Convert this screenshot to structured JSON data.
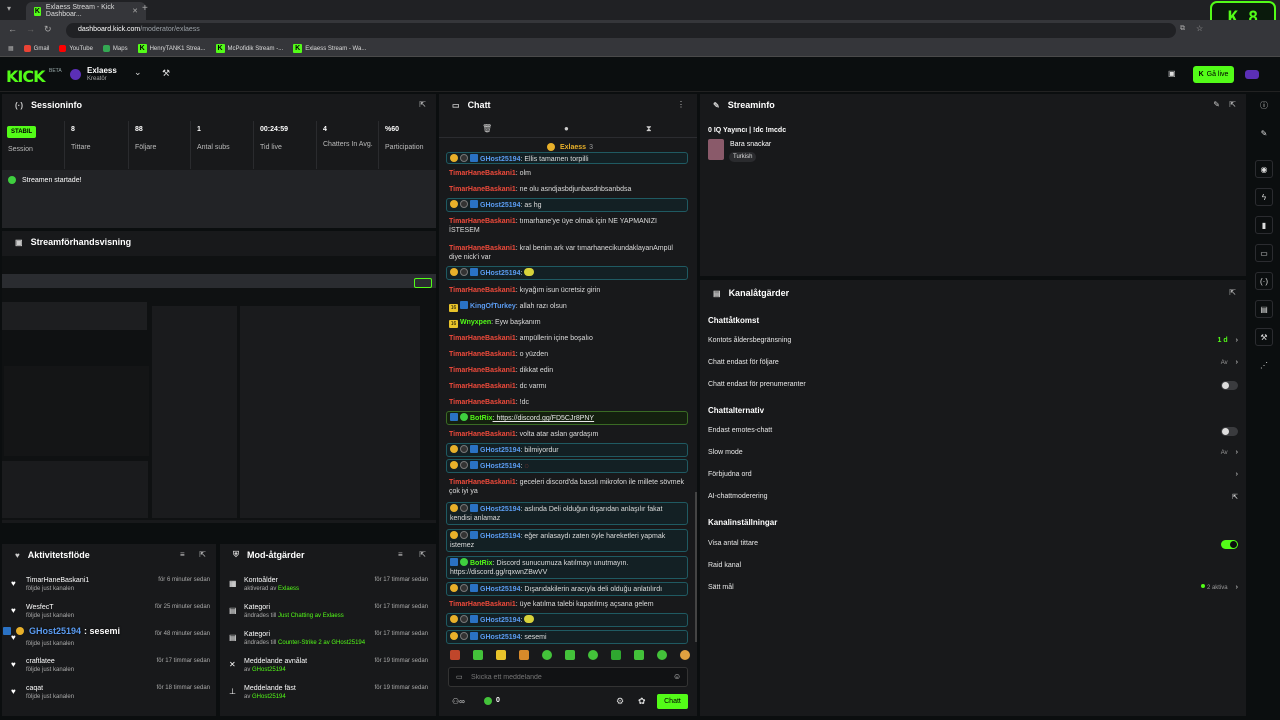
{
  "browser": {
    "tab_title": "Exlaess Stream - Kick Dashboar...",
    "url_host": "dashboard.kick.com",
    "url_path": "/moderator/exlaess",
    "bookmarks": [
      "Gmail",
      "YouTube",
      "Maps",
      "HenryTANK1 Strea...",
      "McPofidik Stream -...",
      "Exlaess Stream - Wa..."
    ]
  },
  "overlay_badge": {
    "letter": "K",
    "number": "8"
  },
  "topbar": {
    "logo": "KICK",
    "beta": "BETA",
    "channel_name": "Exlaess",
    "channel_role": "Kreatör",
    "go_live": "Gå live"
  },
  "session": {
    "title": "Sessioninfo",
    "status_badge": "STABIL",
    "status_label": "Session",
    "stats": [
      {
        "value": "8",
        "label": "Tittare"
      },
      {
        "value": "88",
        "label": "Följare"
      },
      {
        "value": "1",
        "label": "Antal subs"
      },
      {
        "value": "00:24:59",
        "label": "Tid live"
      },
      {
        "value": "4",
        "label": "Chatters In Avg."
      },
      {
        "value": "%60",
        "label": "Participation"
      }
    ],
    "event": "Streamen startade!"
  },
  "preview": {
    "title": "Streamförhandsvisning"
  },
  "activity": {
    "title": "Aktivitetsflöde",
    "items": [
      {
        "name": "TimarHaneBaskani1",
        "sub": "följde just kanalen",
        "time": "för 6 minuter sedan"
      },
      {
        "name": "WesfecT",
        "sub": "följde just kanalen",
        "time": "för 25 minuter sedan"
      },
      {
        "name": "",
        "sub": "följde just kanalen",
        "time": "för 48 minuter sedan"
      },
      {
        "name": "craftlatee",
        "sub": "följde just kanalen",
        "time": "för 17 timmar sedan"
      },
      {
        "name": "caqat",
        "sub": "följde just kanalen",
        "time": "för 18 timmar sedan"
      }
    ],
    "overlay_name": "GHost25194",
    "overlay_msg": ": sesemi"
  },
  "modactions": {
    "title": "Mod-åtgärder",
    "items": [
      {
        "title": "Kontoålder",
        "sub_prefix": "aktiverad av ",
        "sub_link": "Exlaess",
        "time": "för 17 timmar sedan"
      },
      {
        "title": "Kategori",
        "sub_prefix": "ändrades till ",
        "sub_link": "Just Chatting av Exlaess",
        "time": "för 17 timmar sedan"
      },
      {
        "title": "Kategori",
        "sub_prefix": "ändrades till ",
        "sub_link": "Counter-Strike 2 av GHost25194",
        "time": "för 17 timmar sedan"
      },
      {
        "title": "Meddelande avnålat",
        "sub_prefix": "av ",
        "sub_link": "GHost25194",
        "time": "för 19 timmar sedan"
      },
      {
        "title": "Meddelande fäst",
        "sub_prefix": "av ",
        "sub_link": "GHost25194",
        "time": "för 19 timmar sedan"
      }
    ]
  },
  "chat": {
    "title": "Chatt",
    "pinned_user": "Exlaess",
    "pinned_count": "3",
    "messages": [
      {
        "user": "GHost25194",
        "text": ": Ellis tamamen torpilli",
        "style": "box",
        "color": "blue"
      },
      {
        "user": "TimarHaneBaskani1",
        "text": ": olm",
        "style": "plain",
        "color": "red"
      },
      {
        "user": "TimarHaneBaskani1",
        "text": ": ne olu asndjasbdjunbasdnbsanbdsa",
        "style": "plain",
        "color": "red"
      },
      {
        "user": "GHost25194",
        "text": ": as hg",
        "style": "box",
        "color": "blue"
      },
      {
        "user": "TimarHaneBaskani1",
        "text": ": tımarhane'ye üye olmak için NE YAPMANIZI İSTESEM",
        "style": "plain",
        "color": "red"
      },
      {
        "user": "TimarHaneBaskani1",
        "text": ": kral benim ark var tımarhanecikundaklayanAmpül diye nick'i var",
        "style": "plain",
        "color": "red"
      },
      {
        "user": "GHost25194",
        "text": ":",
        "style": "box",
        "color": "blue"
      },
      {
        "user": "TimarHaneBaskani1",
        "text": ": kıyağım isun ücretsiz girin",
        "style": "plain",
        "color": "red"
      },
      {
        "user": "KingOfTurkey",
        "text": ": allah razı olsun",
        "style": "plain",
        "color": "blue"
      },
      {
        "user": "Wnyxpen",
        "text": ": Eyw başkanım",
        "style": "plain",
        "color": "green"
      },
      {
        "user": "TimarHaneBaskani1",
        "text": ": ampüllerin içine boşalıo",
        "style": "plain",
        "color": "red"
      },
      {
        "user": "TimarHaneBaskani1",
        "text": ": o yüzden",
        "style": "plain",
        "color": "red"
      },
      {
        "user": "TimarHaneBaskani1",
        "text": ": dikkat edin",
        "style": "plain",
        "color": "red"
      },
      {
        "user": "TimarHaneBaskani1",
        "text": ": dc varmı",
        "style": "plain",
        "color": "red"
      },
      {
        "user": "TimarHaneBaskani1",
        "text": ": !dc",
        "style": "plain",
        "color": "red"
      },
      {
        "user": "BotRix",
        "text": ": https://discord.gg/FD5CJr8PNY",
        "style": "gbox",
        "color": "green"
      },
      {
        "user": "TimarHaneBaskani1",
        "text": ": volta atar aslan gardaşım",
        "style": "plain",
        "color": "red"
      },
      {
        "user": "GHost25194",
        "text": ": bilmiyordur",
        "style": "box",
        "color": "blue"
      },
      {
        "user": "GHost25194",
        "text": ":",
        "style": "box",
        "color": "blue"
      },
      {
        "user": "TimarHaneBaskani1",
        "text": ": geceleri discord'da basslı mikrofon ile millete sövmek çok iyi ya",
        "style": "plain",
        "color": "red"
      },
      {
        "user": "GHost25194",
        "text": ": aslında Deli olduğun dışarıdan anlaşılır fakat kendisi anlamaz",
        "style": "box",
        "color": "blue"
      },
      {
        "user": "GHost25194",
        "text": ": eğer anlasaydı zaten öyle hareketleri yapmak istemez",
        "style": "box",
        "color": "blue"
      },
      {
        "user": "BotRix",
        "text": ": Discord sunucumuza katılmayı unutmayın. https://discord.gg/rqxwnZBwVV",
        "style": "box",
        "color": "green"
      },
      {
        "user": "GHost25194",
        "text": ": Dışarıdakilerin aracıyla deli olduğu anlatılırdı",
        "style": "box",
        "color": "blue"
      },
      {
        "user": "TimarHaneBaskani1",
        "text": ": üye katılma talebi kapatılmış açsana gelem",
        "style": "plain",
        "color": "red"
      },
      {
        "user": "GHost25194",
        "text": ":",
        "style": "box",
        "color": "blue"
      },
      {
        "user": "GHost25194",
        "text": ": sesemi",
        "style": "box",
        "color": "blue"
      }
    ],
    "input_placeholder": "Skicka ett meddelande",
    "points": "0",
    "send_label": "Chatt"
  },
  "streaminfo": {
    "title": "Streaminfo",
    "stream_title": "0 IQ Yayıncı | !dc !mcdc",
    "category": "Bara snackar",
    "tag": "Turkish"
  },
  "kanal": {
    "title": "Kanalåtgärder",
    "sections": [
      {
        "heading": "Chattåtkomst",
        "rows": [
          {
            "label": "Kontots åldersbegränsning",
            "value": "1 d",
            "control": "chevron",
            "value_color": "green"
          },
          {
            "label": "Chatt endast för följare",
            "value": "Av",
            "control": "chevron",
            "value_color": "muted"
          },
          {
            "label": "Chatt endast för prenumeranter",
            "value": "",
            "control": "toggle-off",
            "value_color": "muted"
          }
        ]
      },
      {
        "heading": "Chattalternativ",
        "rows": [
          {
            "label": "Endast emotes-chatt",
            "value": "",
            "control": "toggle-off",
            "value_color": "muted"
          },
          {
            "label": "Slow mode",
            "value": "Av",
            "control": "chevron",
            "value_color": "muted"
          },
          {
            "label": "Förbjudna ord",
            "value": "",
            "control": "chevron",
            "value_color": "muted"
          },
          {
            "label": "AI-chattmoderering",
            "value": "",
            "control": "external",
            "value_color": "muted"
          }
        ]
      },
      {
        "heading": "Kanalinställningar",
        "rows": [
          {
            "label": "Visa antal tittare",
            "value": "",
            "control": "toggle-on",
            "value_color": "muted"
          },
          {
            "label": "Raid kanal",
            "value": "",
            "control": "none",
            "value_color": "muted"
          },
          {
            "label": "Sätt mål",
            "value": "2 aktiva",
            "control": "chevron",
            "value_color": "muted"
          }
        ]
      }
    ]
  },
  "sidebar_icons": [
    "info-icon",
    "pencil-icon",
    "camera-icon",
    "bolt-icon",
    "trash-icon",
    "chat-icon",
    "broadcast-icon",
    "layout-icon",
    "wrench-icon",
    "share-icon"
  ],
  "colors": {
    "brand": "#53fc18",
    "panel": "#18191b",
    "background": "#0b0e0f",
    "chat_red": "#f04a3b",
    "chat_blue": "#5b9cf2"
  }
}
